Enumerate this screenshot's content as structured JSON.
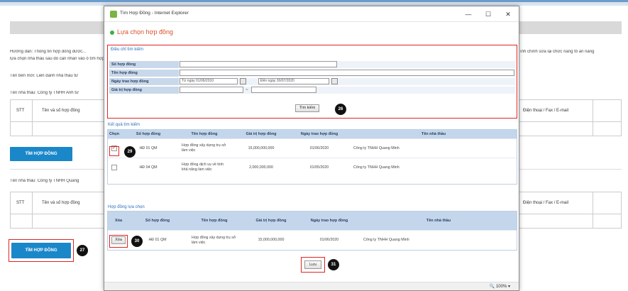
{
  "background": {
    "guide_text_1": "Hướng dẫn: Thông tin hợp đồng được...",
    "guide_text_2": "lựa chọn nhà thầu sau đó cần nhấn vào ô tìm hợp đồng",
    "guide_right_1": "ính chính sửa lại chức năng tổ ăn năng",
    "bid_package": "Tên bên mời: Liên danh nhà thầu tư",
    "contractor_1": "Tên nhà thầu: Công ty TNHH Anh tư",
    "contractor_2": "Tên nhà thầu: Công ty TNHH Quang",
    "table_headers": {
      "stt": "STT",
      "contract": "Tên và số hợp đồng",
      "phone": "Điện thoại / Fax / E-mail"
    },
    "find_button_1": "TÌM HỢP ĐỒNG",
    "find_button_2": "TÌM HỢP ĐỒNG"
  },
  "window": {
    "title": "Tìm Hợp Đồng - Internet Explorer",
    "minimize": "—",
    "maximize": "☐",
    "close": "✕"
  },
  "dialog": {
    "heading": "Lựa chọn hợp đồng",
    "search": {
      "legend": "Điều chỉ tìm kiếm",
      "labels": {
        "contract_no": "Số hợp đồng",
        "contract_name": "Tên hợp đồng",
        "sign_date": "Ngày trao hợp đồng",
        "value": "Giá trị hợp đồng"
      },
      "from_label": "Từ ngày",
      "from_value": "01/06/2010",
      "to_label": "Đến ngày",
      "to_value": "30/07/2020",
      "range_sep": "~",
      "search_button": "Tìm kiếm"
    },
    "results": {
      "legend": "Kết quả tìm kiếm",
      "headers": [
        "Chọn",
        "Số hợp đồng",
        "Tên hợp đồng",
        "Giá trị hợp đồng",
        "Ngày trao hợp đồng",
        "Tên nhà thầu"
      ],
      "rows": [
        {
          "checked": "✓",
          "no": "HĐ 01 QM",
          "name": "Hợp đồng xây dựng trụ sở làm việc",
          "value": "15,000,000,000",
          "date": "01/06/2020",
          "contractor": "Công ty TNHH Quang Minh"
        },
        {
          "checked": "",
          "no": "HĐ 04 QM",
          "name": "Hợp đồng dịch vụ về tính khả năng làm việc",
          "value": "2,000,000,000",
          "date": "01/05/2020",
          "contractor": "Công ty TNHH Quang Minh"
        }
      ]
    },
    "selected": {
      "legend": "Hợp đồng lựa chọn",
      "headers": [
        "Xóa",
        "Số hợp đồng",
        "Tên hợp đồng",
        "Giá trị hợp đồng",
        "Ngày trao hợp đồng",
        "Tên nhà thầu"
      ],
      "rows": [
        {
          "delete": "Xóa",
          "no": "HĐ 01 QM",
          "name": "Hợp đồng xây dựng trụ sở làm việc",
          "value": "15,000,000,000",
          "date": "01/06/2020",
          "contractor": "Công ty TNHH Quang Minh"
        }
      ]
    },
    "save_button": "Lưu"
  },
  "status": {
    "zoom": "100%"
  },
  "callouts": {
    "b26": "26",
    "b27": "27",
    "b29": "29",
    "b30": "30",
    "b31": "31"
  },
  "colors": {
    "accent_red": "#e02424",
    "button_blue": "#1a87c9",
    "header_blue": "#c3d6ec"
  }
}
